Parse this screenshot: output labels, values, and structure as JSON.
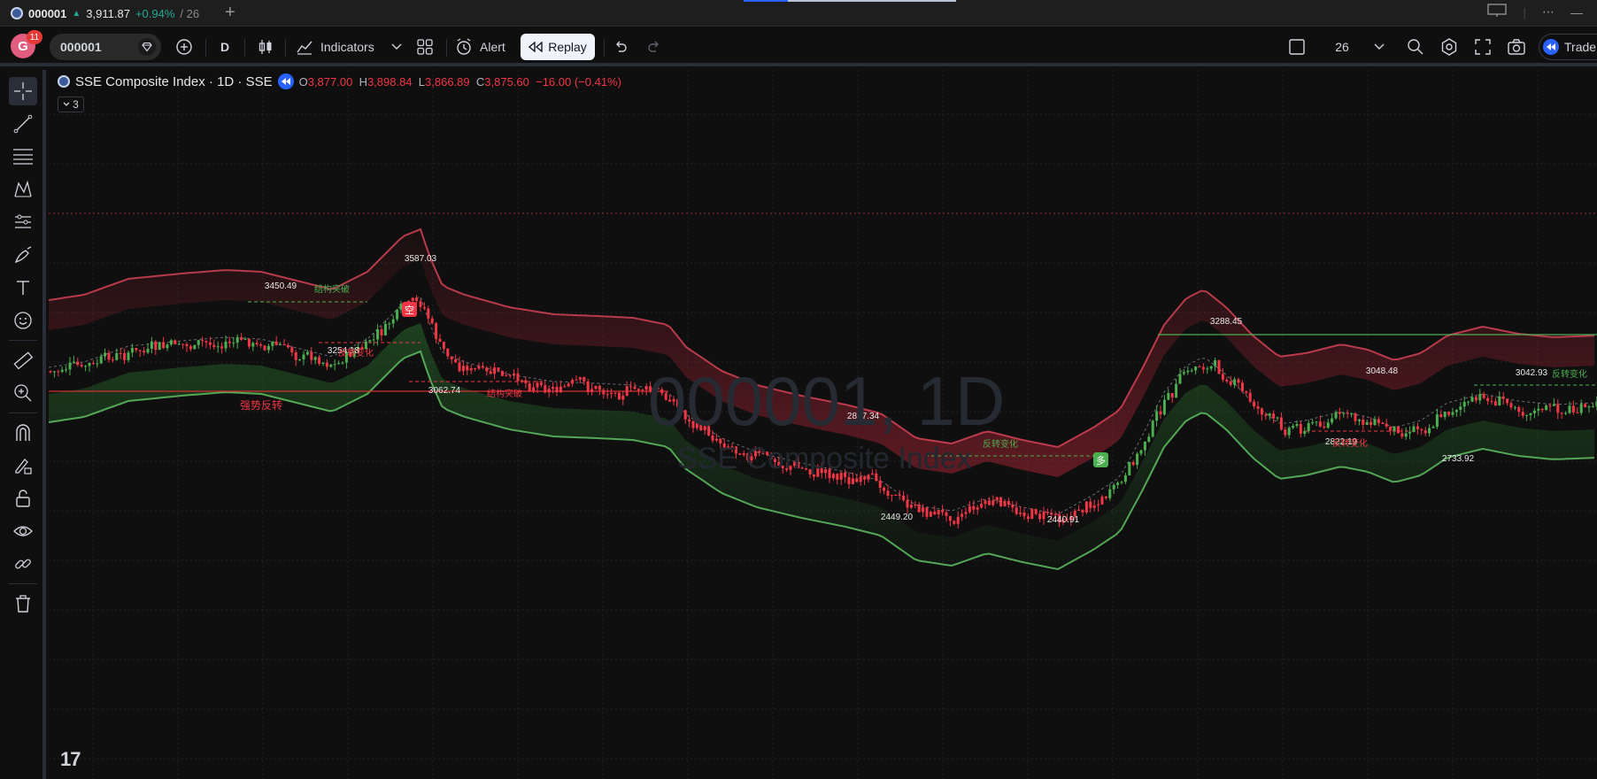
{
  "browser_tab": {
    "symbol": "000001",
    "price": "3,911.87",
    "change": "+0.94%",
    "more": "/ 26",
    "new_tab": "+"
  },
  "toolbar": {
    "avatar_letter": "G",
    "notification_count": "11",
    "symbol": "000001",
    "interval": "D",
    "indicators_label": "Indicators",
    "alert_label": "Alert",
    "replay_label": "Replay",
    "layout_value": "26",
    "trade_label": "Trade"
  },
  "legend": {
    "title": "SSE Composite Index · 1D · SSE",
    "o_key": "O",
    "o_val": "3,877.00",
    "h_key": "H",
    "h_val": "3,898.84",
    "l_key": "L",
    "l_val": "3,866.89",
    "c_key": "C",
    "c_val": "3,875.60",
    "change": "−16.00 (−0.41%)",
    "indicator_count": "3"
  },
  "watermark": {
    "symbol": "000001, 1D",
    "name": "SSE Composite Index"
  },
  "price_labels": [
    "3587.03",
    "3450.49",
    "3254.18",
    "3062.74",
    "3288.45",
    "2827.34",
    "2449.20",
    "2440.91",
    "3048.48",
    "2822.19",
    "3042.93",
    "2733.92"
  ],
  "annotations": {
    "structure_break_1": "结构突破",
    "reversal_1": "反转变化",
    "structure_break_2": "结构突破",
    "strong_reversal": "强势反转",
    "reversal_2": "反转变化",
    "reversal_3": "反转变化",
    "reversal_4": "反转变化",
    "short_marker": "空",
    "long_marker": "多"
  },
  "colors": {
    "background": "#0f0f0f",
    "up": "#4caf50",
    "down": "#f23645",
    "band_upper": "#c0283a",
    "band_lower": "#2e7d32",
    "replay_button_bg": "#f0f3fa"
  },
  "logo_text": "17",
  "chart_data": {
    "type": "candlestick",
    "title": "SSE Composite Index · 1D · SSE",
    "interval": "1D",
    "visible_last_bar": {
      "open": 3877.0,
      "high": 3898.84,
      "low": 3866.89,
      "close": 3875.6,
      "change": -16.0,
      "change_pct": -0.41
    },
    "swing_points": [
      {
        "label": "3450.49",
        "type": "high"
      },
      {
        "label": "3587.03",
        "type": "high"
      },
      {
        "label": "3254.18",
        "type": "low"
      },
      {
        "label": "3062.74",
        "type": "low"
      },
      {
        "label": "2827.34",
        "type": "high"
      },
      {
        "label": "2449.20",
        "type": "low"
      },
      {
        "label": "2440.91",
        "type": "low"
      },
      {
        "label": "3288.45",
        "type": "high"
      },
      {
        "label": "3048.48",
        "type": "high"
      },
      {
        "label": "2822.19",
        "type": "low"
      },
      {
        "label": "3042.93",
        "type": "high"
      },
      {
        "label": "2733.92",
        "type": "low"
      }
    ],
    "price_range_approx": [
      2440,
      3590
    ]
  }
}
